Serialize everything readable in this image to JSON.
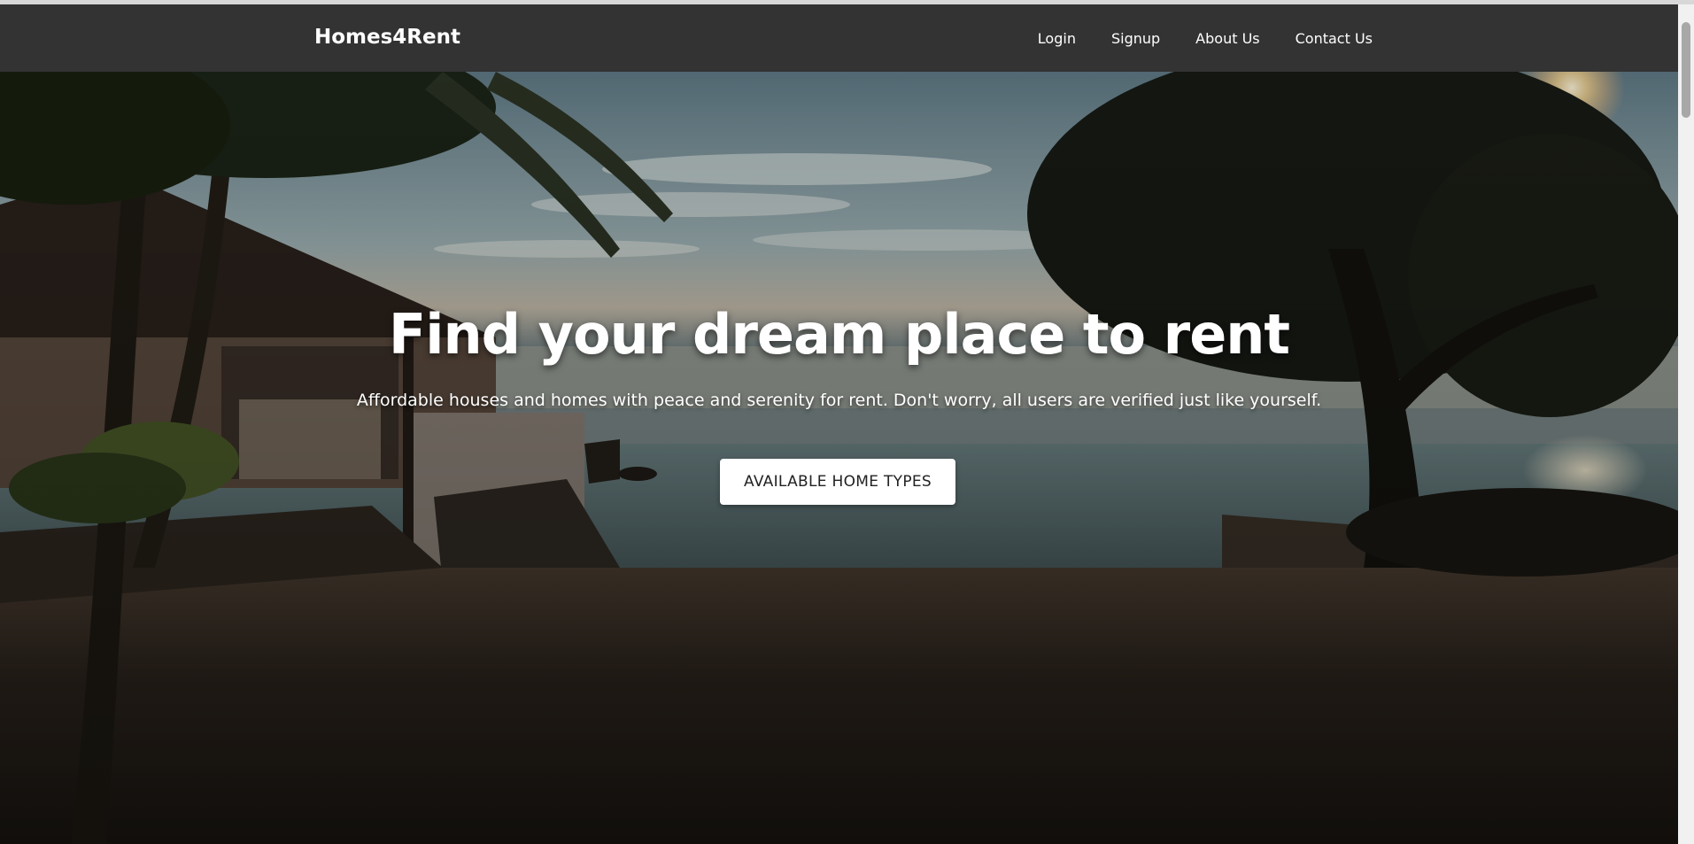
{
  "nav": {
    "brand": "Homes4Rent",
    "links": [
      "Login",
      "Signup",
      "About Us",
      "Contact Us"
    ]
  },
  "hero": {
    "title": "Find your dream place to rent",
    "subtitle": "Affordable houses and homes with peace and serenity for rent. Don't worry, all users are verified just like yourself.",
    "cta_label": "AVAILABLE HOME TYPES"
  },
  "colors": {
    "navbar_bg": "#333333",
    "nav_text": "#ffffff",
    "button_bg": "#ffffff",
    "button_text": "#222222"
  },
  "icons": {
    "background": "beach-house-sunset-photo"
  }
}
